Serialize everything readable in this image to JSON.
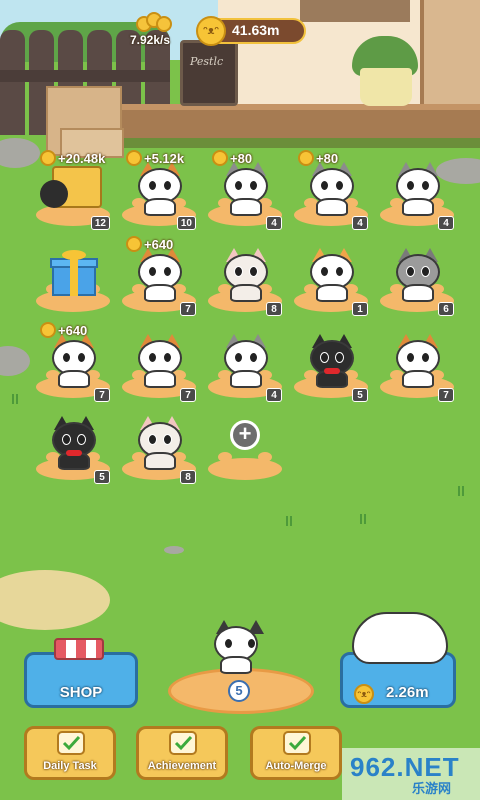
{
  "currency": {
    "rate": "7.92k/s",
    "balance": "41.63m"
  },
  "grid": [
    {
      "kind": "crate",
      "level": "12",
      "earn": "+20.48k"
    },
    {
      "kind": "cat",
      "style": "calico-sleepy",
      "level": "10",
      "earn": "+5.12k"
    },
    {
      "kind": "cat",
      "style": "white-grey",
      "level": "4",
      "earn": "+80"
    },
    {
      "kind": "cat",
      "style": "white-grey",
      "level": "4",
      "earn": "+80"
    },
    {
      "kind": "cat",
      "style": "white-grey",
      "level": "4",
      "earn": ""
    },
    {
      "kind": "gift",
      "level": "",
      "earn": ""
    },
    {
      "kind": "cat",
      "style": "calico-sleepy",
      "level": "7",
      "earn": "+640"
    },
    {
      "kind": "cat",
      "style": "sphynx",
      "level": "8",
      "earn": ""
    },
    {
      "kind": "cat",
      "style": "calico",
      "level": "1",
      "earn": ""
    },
    {
      "kind": "cat",
      "style": "grey-white",
      "level": "6",
      "earn": ""
    },
    {
      "kind": "cat",
      "style": "calico-sleepy",
      "level": "7",
      "earn": "+640"
    },
    {
      "kind": "cat",
      "style": "calico-sleepy",
      "level": "7",
      "earn": ""
    },
    {
      "kind": "cat",
      "style": "white-grey",
      "level": "4",
      "earn": ""
    },
    {
      "kind": "cat",
      "style": "tuxedo",
      "level": "5",
      "earn": ""
    },
    {
      "kind": "cat",
      "style": "calico-sleepy",
      "level": "7",
      "earn": ""
    },
    {
      "kind": "cat",
      "style": "tuxedo",
      "level": "5",
      "earn": ""
    },
    {
      "kind": "cat",
      "style": "sphynx",
      "level": "8",
      "earn": ""
    },
    {
      "kind": "add",
      "level": "",
      "earn": ""
    }
  ],
  "shop": {
    "label": "SHOP"
  },
  "center": {
    "level": "5"
  },
  "buy": {
    "price": "2.26m"
  },
  "tasks": [
    {
      "label": "Daily Task",
      "icon": "checklist-icon"
    },
    {
      "label": "Achievement",
      "icon": "medal-icon"
    },
    {
      "label": "Auto-Merge",
      "icon": "magic-wand-icon"
    }
  ],
  "board": {
    "text": "Pestlc"
  },
  "watermark": {
    "main": "962.NET",
    "sub": "乐游网"
  },
  "colors": {
    "grass": "#7cc24a",
    "button_blue": "#4fb0e8",
    "button_gold": "#f5c85a",
    "coin": "#f7c436",
    "paw": "#f4b86a"
  }
}
